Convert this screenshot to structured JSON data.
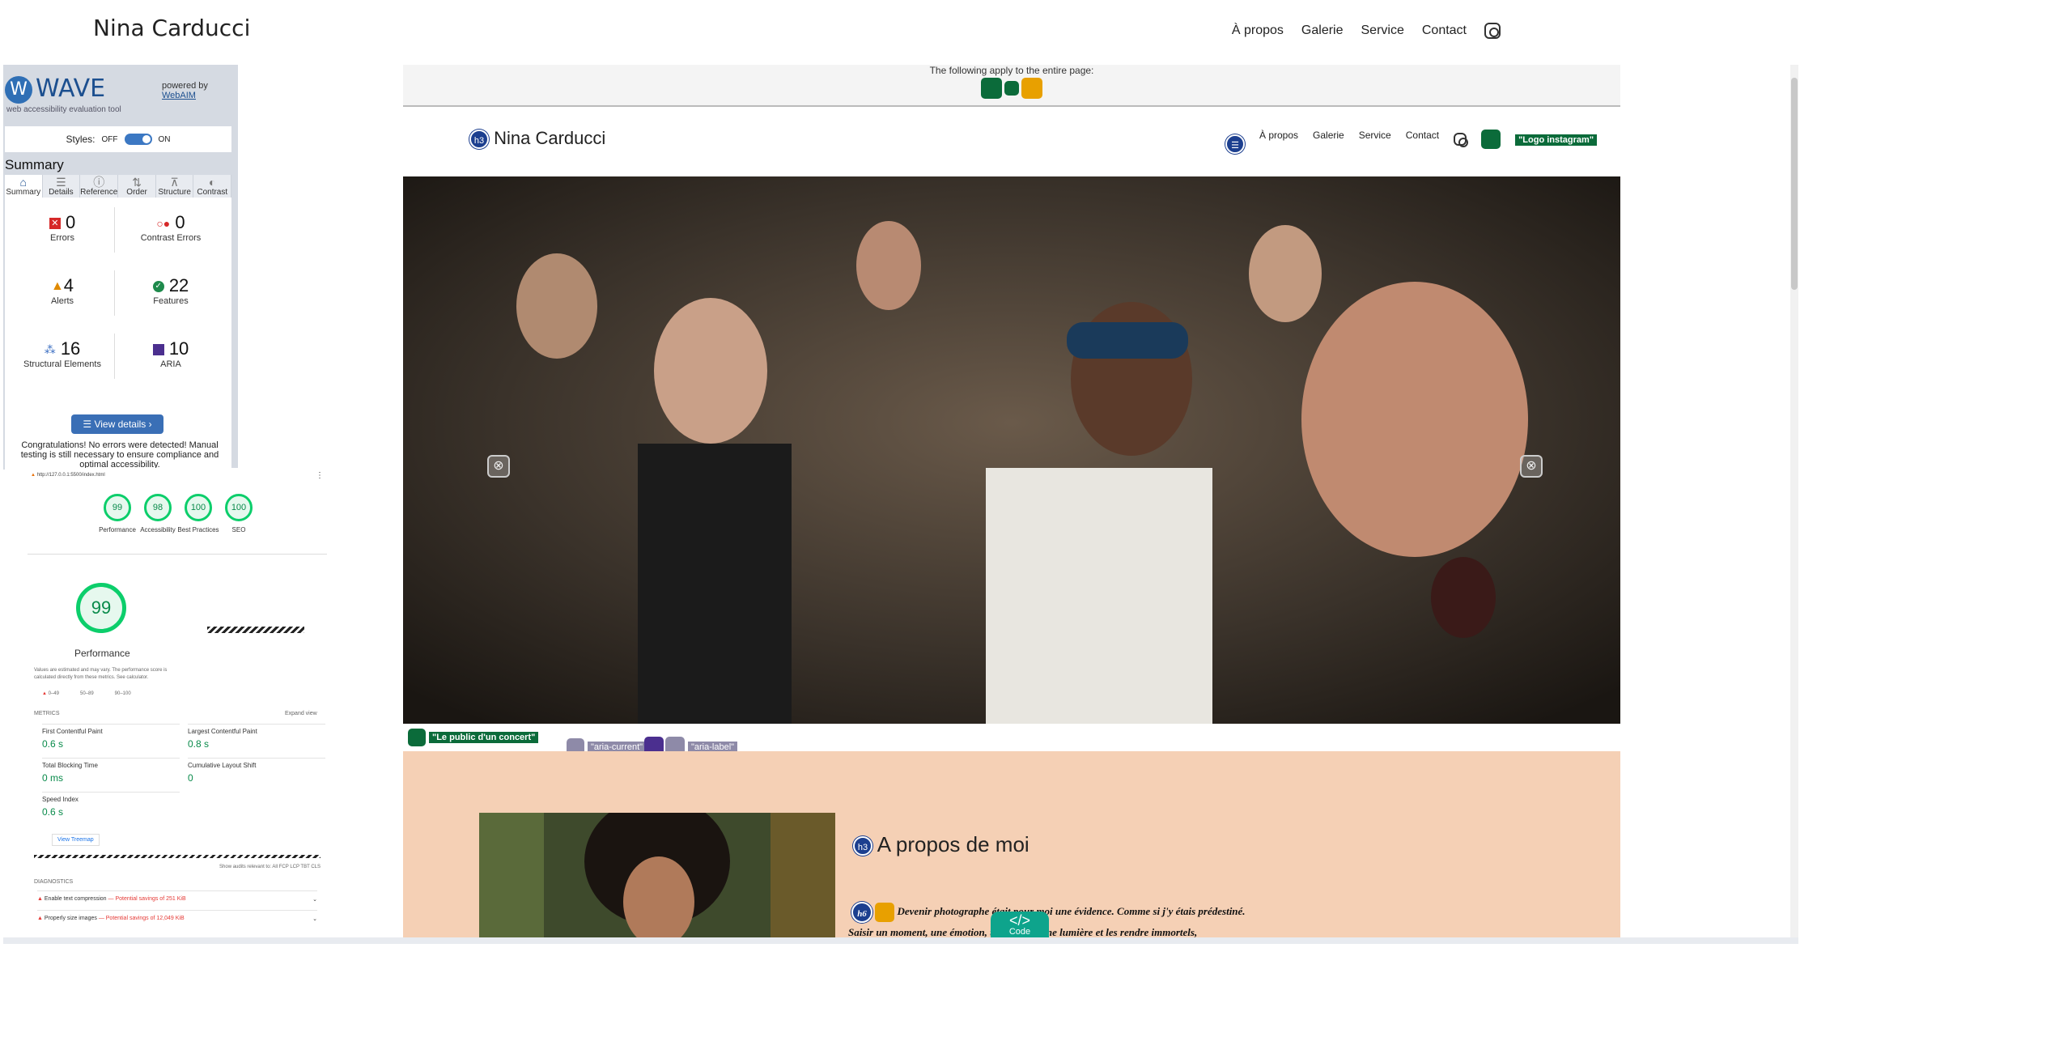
{
  "site": {
    "title": "Nina Carducci",
    "nav": [
      "À propos",
      "Galerie",
      "Service",
      "Contact"
    ]
  },
  "wave": {
    "logo": "WAVE",
    "tagline": "web accessibility evaluation tool",
    "powered_by": "powered by",
    "webaim": "WebAIM",
    "styles_label": "Styles:",
    "off": "OFF",
    "on": "ON",
    "summary_heading": "Summary",
    "tabs": [
      "Summary",
      "Details",
      "Reference",
      "Order",
      "Structure",
      "Contrast"
    ],
    "stats": {
      "errors": {
        "value": "0",
        "label": "Errors"
      },
      "contrast": {
        "value": "0",
        "label": "Contrast Errors"
      },
      "alerts": {
        "value": "4",
        "label": "Alerts"
      },
      "features": {
        "value": "22",
        "label": "Features"
      },
      "structural": {
        "value": "16",
        "label": "Structural Elements"
      },
      "aria": {
        "value": "10",
        "label": "ARIA"
      }
    },
    "view_details": "View details ›",
    "congrats": "Congratulations! No errors were detected! Manual testing is still necessary to ensure compliance and optimal accessibility."
  },
  "lighthouse": {
    "url": "http://127.0.0.1:5500/index.html",
    "scores": [
      {
        "value": "99",
        "label": "Performance"
      },
      {
        "value": "98",
        "label": "Accessibility"
      },
      {
        "value": "100",
        "label": "Best Practices"
      },
      {
        "value": "100",
        "label": "SEO"
      }
    ],
    "main_score": "99",
    "main_label": "Performance",
    "note": "Values are estimated and may vary. The performance score is calculated directly from these metrics. See calculator.",
    "legend": [
      "0–49",
      "50–89",
      "90–100"
    ],
    "metrics_heading": "METRICS",
    "expand": "Expand view",
    "metrics": [
      {
        "name": "First Contentful Paint",
        "value": "0.6 s"
      },
      {
        "name": "Largest Contentful Paint",
        "value": "0.8 s"
      },
      {
        "name": "Total Blocking Time",
        "value": "0 ms"
      },
      {
        "name": "Cumulative Layout Shift",
        "value": "0"
      },
      {
        "name": "Speed Index",
        "value": "0.6 s"
      }
    ],
    "treemap": "View Treemap",
    "show_audits": "Show audits relevant to:  All  FCP  LCP  TBT  CLS",
    "diagnostics_heading": "DIAGNOSTICS",
    "diagnostics": [
      {
        "name": "Enable text compression",
        "saving": "— Potential savings of 251 KiB"
      },
      {
        "name": "Properly size images",
        "saving": "— Potential savings of 12,049 KiB"
      }
    ]
  },
  "page": {
    "applies": "The following apply to the entire page:",
    "inner_title": "Nina Carducci",
    "inner_nav": [
      "À propos",
      "Galerie",
      "Service",
      "Contact"
    ],
    "logo_alt": "\"Logo instagram\"",
    "hero_alt": "\"Le public d'un concert\"",
    "aria_current": "\"aria-current\"",
    "aria_label": "\"aria-label\"",
    "about_heading": "A propos de moi",
    "quote_line1": "Devenir photographe était pour moi une évidence. Comme si j'y étais prédestiné.",
    "quote_line2": "Saisir un moment, une émotion, un endroit, une lumière et les rendre immortels,",
    "h3": "h3",
    "h6": "h6",
    "code_label": "Code"
  }
}
